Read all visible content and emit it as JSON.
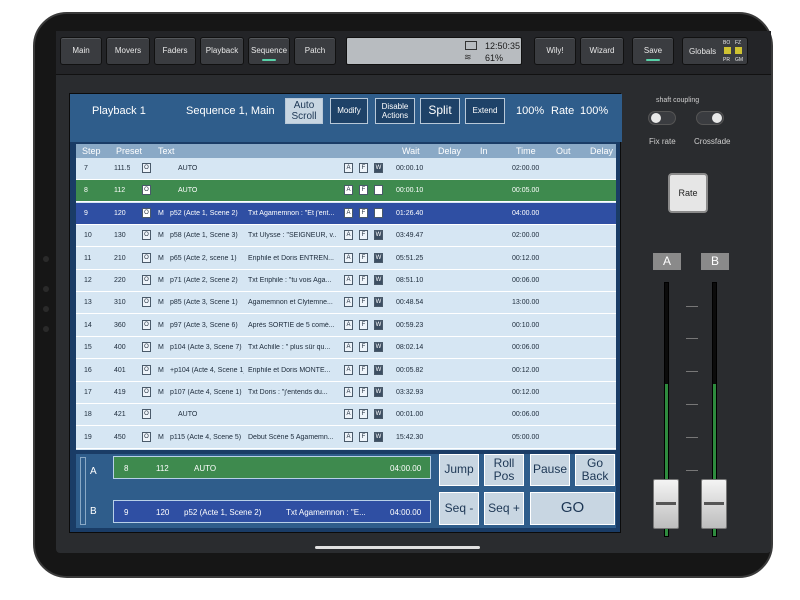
{
  "topbar": {
    "buttons": [
      {
        "label": "Main",
        "active": false
      },
      {
        "label": "Movers",
        "active": false
      },
      {
        "label": "Faders",
        "active": false
      },
      {
        "label": "Playback",
        "active": false
      },
      {
        "label": "Sequence",
        "active": true
      },
      {
        "label": "Patch",
        "active": false
      }
    ],
    "status_time": "12:50:35",
    "status_battery": "61%",
    "right_buttons": [
      {
        "label": "Wily!",
        "active": false
      },
      {
        "label": "Wizard",
        "active": false
      },
      {
        "label": "Save",
        "active": true
      }
    ],
    "globals_label": "Globals",
    "globals_indicators": [
      "BO",
      "FZ",
      "PR",
      "GM"
    ]
  },
  "header": {
    "playback": "Playback 1",
    "sequence": "Sequence 1, Main",
    "auto_scroll": "Auto Scroll",
    "modify": "Modify",
    "disable_actions": "Disable Actions",
    "split": "Split",
    "extend": "Extend",
    "percent_left": "100%",
    "rate_label": "Rate",
    "percent_right": "100%"
  },
  "columns": [
    "Step",
    "Preset",
    "Text",
    "Wait",
    "Delay",
    "In",
    "Time",
    "Out",
    "Delay"
  ],
  "rows": [
    {
      "step": "7",
      "preset": "111.5",
      "o": "O",
      "m": "",
      "cue": "",
      "text": "AUTO",
      "wait": "00:00.10",
      "time": "02:00.00",
      "state": ""
    },
    {
      "step": "8",
      "preset": "112",
      "o": "O",
      "m": "",
      "cue": "",
      "text": "AUTO",
      "wait": "00:00.10",
      "time": "00:05.00",
      "state": "a"
    },
    {
      "step": "9",
      "preset": "120",
      "o": "O",
      "m": "M",
      "cue": "p52 (Acte 1, Scene 2)",
      "text": "Txt Agamemnon : \"Et j'ent...",
      "wait": "01:26.40",
      "time": "04:00.00",
      "state": "b"
    },
    {
      "step": "10",
      "preset": "130",
      "o": "O",
      "m": "M",
      "cue": "p58 (Acte 1, Scene 3)",
      "text": "Txt Ulysse : \"SEIGNEUR, v...",
      "wait": "03:49.47",
      "time": "02:00.00",
      "state": ""
    },
    {
      "step": "11",
      "preset": "210",
      "o": "O",
      "m": "M",
      "cue": "p65 (Acte 2, scene 1)",
      "text": "Eriphile et Doris ENTREN...",
      "wait": "05:51.25",
      "time": "00:12.00",
      "state": ""
    },
    {
      "step": "12",
      "preset": "220",
      "o": "O",
      "m": "M",
      "cue": "p71 (Acte 2, Scene 2)",
      "text": "Txt Eriphile : \"tu vois Aga...",
      "wait": "08:51.10",
      "time": "00:06.00",
      "state": ""
    },
    {
      "step": "13",
      "preset": "310",
      "o": "O",
      "m": "M",
      "cue": "p85 (Acte 3, Scene 1)",
      "text": "Agamemnon et Clytemne...",
      "wait": "00:48.54",
      "time": "13:00.00",
      "state": ""
    },
    {
      "step": "14",
      "preset": "360",
      "o": "O",
      "m": "M",
      "cue": "p97 (Acte 3, Scene 6)",
      "text": "Après SORTIE de 5 comé...",
      "wait": "00:59.23",
      "time": "00:10.00",
      "state": ""
    },
    {
      "step": "15",
      "preset": "400",
      "o": "O",
      "m": "M",
      "cue": "p104 (Acte 3, Scene 7)",
      "text": "Txt Achille : \" plus sûr qu...",
      "wait": "08:02.14",
      "time": "00:06.00",
      "state": ""
    },
    {
      "step": "16",
      "preset": "401",
      "o": "O",
      "m": "M",
      "cue": "+p104 (Acte 4, Scene 1)",
      "text": "Eriphile et Doris MONTE...",
      "wait": "00:05.82",
      "time": "00:12.00",
      "state": ""
    },
    {
      "step": "17",
      "preset": "419",
      "o": "O",
      "m": "M",
      "cue": "p107 (Acte 4, Scene 1)",
      "text": "Txt Doris : \"j'entends du...",
      "wait": "03:32.93",
      "time": "00:12.00",
      "state": ""
    },
    {
      "step": "18",
      "preset": "421",
      "o": "O",
      "m": "",
      "cue": "",
      "text": "AUTO",
      "wait": "00:01.00",
      "time": "00:06.00",
      "state": ""
    },
    {
      "step": "19",
      "preset": "450",
      "o": "O",
      "m": "M",
      "cue": "p115 (Acte 4, Scene 5)",
      "text": "Debut Scène 5 Agamemn...",
      "wait": "15:42.30",
      "time": "05:00.00",
      "state": ""
    }
  ],
  "chips": [
    "A",
    "F",
    "W"
  ],
  "bottom": {
    "a_label": "A",
    "b_label": "B",
    "a_step": "8",
    "a_preset": "112",
    "a_text": "AUTO",
    "a_time": "04:00.00",
    "b_step": "9",
    "b_preset": "120",
    "b_cue": "p52 (Acte 1, Scene 2)",
    "b_text": "Txt Agamemnon : \"E...",
    "b_time": "04:00.00",
    "jump": "Jump",
    "roll_pos": "Roll Pos",
    "pause": "Pause",
    "go_back": "Go Back",
    "seq_minus": "Seq -",
    "seq_plus": "Seq +",
    "go": "GO"
  },
  "right": {
    "shaft_coupling": "shaft coupling",
    "fix_rate": "Fix rate",
    "crossfade": "Crossfade",
    "rate": "Rate",
    "fader_a": "A",
    "fader_b": "B"
  }
}
